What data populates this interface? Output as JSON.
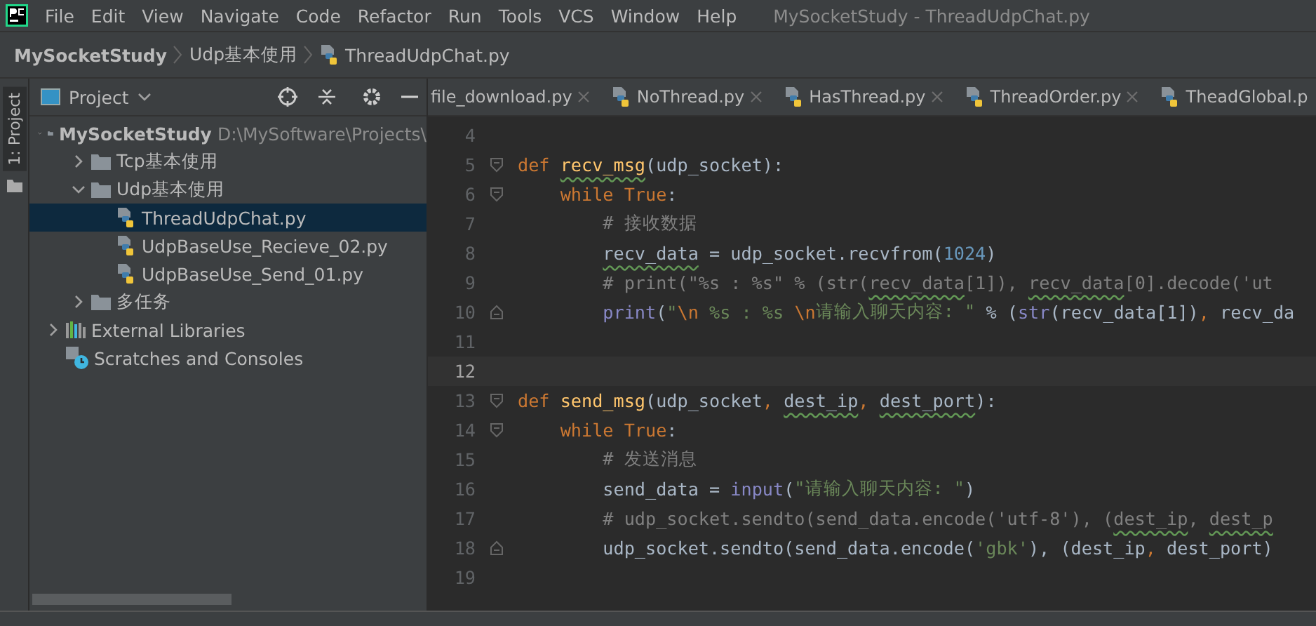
{
  "menu": [
    "File",
    "Edit",
    "View",
    "Navigate",
    "Code",
    "Refactor",
    "Run",
    "Tools",
    "VCS",
    "Window",
    "Help"
  ],
  "window": {
    "title": "MySocketStudy - ThreadUdpChat.py"
  },
  "breadcrumbs": [
    {
      "label": "MySocketStudy",
      "kind": "project"
    },
    {
      "label": "Udp基本使用",
      "kind": "folder"
    },
    {
      "label": "ThreadUdpChat.py",
      "kind": "file"
    }
  ],
  "side_strip": {
    "label": "1: Project"
  },
  "project_panel": {
    "title": "Project",
    "tree": [
      {
        "label": "MySocketStudy",
        "path": "D:\\MySoftware\\Projects\\",
        "kind": "folder",
        "expanded": true,
        "selected": false,
        "children": [
          {
            "label": "Tcp基本使用",
            "kind": "folder",
            "expanded": false,
            "selected": false
          },
          {
            "label": "Udp基本使用",
            "kind": "folder",
            "expanded": true,
            "selected": false,
            "children": [
              {
                "label": "ThreadUdpChat.py",
                "kind": "file",
                "selected": true
              },
              {
                "label": "UdpBaseUse_Recieve_02.py",
                "kind": "file",
                "selected": false
              },
              {
                "label": "UdpBaseUse_Send_01.py",
                "kind": "file",
                "selected": false
              }
            ]
          },
          {
            "label": "多任务",
            "kind": "folder",
            "expanded": false,
            "selected": false
          }
        ]
      },
      {
        "label": "External Libraries",
        "kind": "libraries",
        "expanded": false,
        "selected": false
      },
      {
        "label": "Scratches and Consoles",
        "kind": "scratches",
        "selected": false
      }
    ]
  },
  "tabs": [
    {
      "label": "file_download.py",
      "selected": false,
      "icon": false,
      "closable": true
    },
    {
      "label": "NoThread.py",
      "selected": false,
      "icon": true,
      "closable": true
    },
    {
      "label": "HasThread.py",
      "selected": false,
      "icon": true,
      "closable": true
    },
    {
      "label": "ThreadOrder.py",
      "selected": false,
      "icon": true,
      "closable": true
    },
    {
      "label": "TheadGlobal.p",
      "selected": false,
      "icon": true,
      "closable": false
    }
  ],
  "code": [
    {
      "number": "4",
      "current": false
    },
    {
      "number": "5",
      "current": false,
      "fold_start": true,
      "tokens": [
        {
          "text": "def",
          "kind": "kw"
        },
        {
          "text": " recv_msg",
          "kind": "fn",
          "squiggle": true
        },
        {
          "text": "(udp_socket):",
          "kind": "plain"
        }
      ]
    },
    {
      "number": "6",
      "current": false,
      "fold_start": true,
      "tokens": [
        {
          "text": "    while True",
          "kind": "kw"
        },
        {
          "text": ":",
          "kind": "plain"
        }
      ]
    },
    {
      "number": "7",
      "current": false,
      "tokens": [
        {
          "text": "        # 接收数据",
          "kind": "comment"
        }
      ]
    },
    {
      "number": "8",
      "current": false,
      "tokens": [
        {
          "text": "        recv_data",
          "kind": "plain",
          "squiggle": true
        },
        {
          "text": " = udp_socket.recvfrom(",
          "kind": "plain"
        },
        {
          "text": "1024",
          "kind": "num"
        },
        {
          "text": ")",
          "kind": "plain"
        }
      ]
    },
    {
      "number": "9",
      "current": false,
      "tokens": [
        {
          "text": "        # print(\"%s : %s\" % (str(",
          "kind": "comment"
        },
        {
          "text": "recv_data",
          "kind": "comment",
          "squiggle": true
        },
        {
          "text": "[1]),",
          "kind": "comment"
        },
        {
          "text": " recv_data",
          "kind": "comment",
          "squiggle": true
        },
        {
          "text": "[0].decode('ut",
          "kind": "comment"
        }
      ]
    },
    {
      "number": "10",
      "current": false,
      "fold_end": true,
      "tokens": [
        {
          "text": "        print",
          "kind": "builtin"
        },
        {
          "text": "(",
          "kind": "plain"
        },
        {
          "text": "\"",
          "kind": "str"
        },
        {
          "text": "\\n",
          "kind": "esc"
        },
        {
          "text": " %s : %s ",
          "kind": "str"
        },
        {
          "text": "\\n",
          "kind": "esc"
        },
        {
          "text": "请输入聊天内容: \"",
          "kind": "str"
        },
        {
          "text": " % (",
          "kind": "plain"
        },
        {
          "text": "str",
          "kind": "builtin"
        },
        {
          "text": "(recv_data[1])",
          "kind": "plain"
        },
        {
          "text": ",",
          "kind": "esc"
        },
        {
          "text": " recv_da",
          "kind": "plain"
        }
      ]
    },
    {
      "number": "11",
      "current": false
    },
    {
      "number": "12",
      "current": true
    },
    {
      "number": "13",
      "current": false,
      "fold_start": true,
      "tokens": [
        {
          "text": "def",
          "kind": "kw"
        },
        {
          "text": " send_msg",
          "kind": "fn"
        },
        {
          "text": "(udp_socket",
          "kind": "plain"
        },
        {
          "text": ",",
          "kind": "esc"
        },
        {
          "text": " dest_ip",
          "kind": "plain",
          "squiggle": true
        },
        {
          "text": ",",
          "kind": "esc"
        },
        {
          "text": " dest_port",
          "kind": "plain",
          "squiggle": true
        },
        {
          "text": "):",
          "kind": "plain"
        }
      ]
    },
    {
      "number": "14",
      "current": false,
      "fold_start": true,
      "tokens": [
        {
          "text": "    while True",
          "kind": "kw"
        },
        {
          "text": ":",
          "kind": "plain"
        }
      ]
    },
    {
      "number": "15",
      "current": false,
      "tokens": [
        {
          "text": "        # 发送消息",
          "kind": "comment"
        }
      ]
    },
    {
      "number": "16",
      "current": false,
      "tokens": [
        {
          "text": "        send_data = ",
          "kind": "plain"
        },
        {
          "text": "input",
          "kind": "builtin"
        },
        {
          "text": "(",
          "kind": "plain"
        },
        {
          "text": "\"请输入聊天内容: \"",
          "kind": "str"
        },
        {
          "text": ")",
          "kind": "plain"
        }
      ]
    },
    {
      "number": "17",
      "current": false,
      "tokens": [
        {
          "text": "        # udp_socket.sendto(send_data.encode('utf-8'), (",
          "kind": "comment"
        },
        {
          "text": "dest_ip",
          "kind": "comment",
          "squiggle": true
        },
        {
          "text": ",",
          "kind": "comment"
        },
        {
          "text": " dest_p",
          "kind": "comment",
          "squiggle": true
        }
      ]
    },
    {
      "number": "18",
      "current": false,
      "fold_end": true,
      "tokens": [
        {
          "text": "        udp_socket.sendto(send_data.encode(",
          "kind": "plain"
        },
        {
          "text": "'gbk'",
          "kind": "str"
        },
        {
          "text": "), (dest_ip",
          "kind": "plain"
        },
        {
          "text": ",",
          "kind": "esc"
        },
        {
          "text": " dest_port)",
          "kind": "plain"
        }
      ]
    },
    {
      "number": "19",
      "current": false
    }
  ]
}
